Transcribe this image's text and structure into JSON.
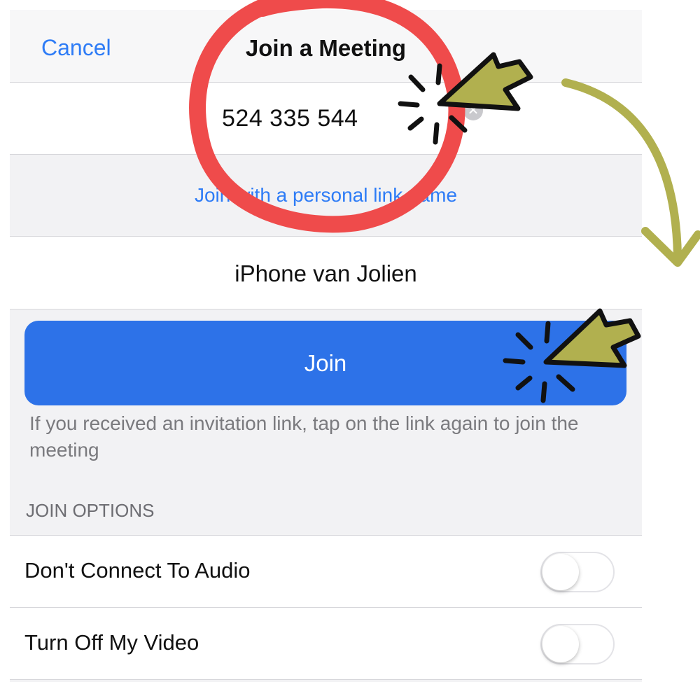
{
  "navbar": {
    "cancel_label": "Cancel",
    "title": "Join a Meeting"
  },
  "meeting": {
    "id_value": "524 335 544",
    "clear_icon": "clear-icon"
  },
  "personal_link": {
    "label": "Join with a personal link name"
  },
  "name_field": {
    "value": "iPhone van Jolien"
  },
  "join_button": {
    "label": "Join"
  },
  "invite_hint": "If you received an invitation link, tap on the link again to join the meeting",
  "join_options": {
    "header": "JOIN OPTIONS",
    "items": [
      {
        "label": "Don't Connect To Audio",
        "enabled": false
      },
      {
        "label": "Turn Off My Video",
        "enabled": false
      }
    ]
  },
  "colors": {
    "accent": "#2e7cf6",
    "join_button": "#2d72e8",
    "annotation_circle": "#ef4b4b",
    "annotation_arrow": "#b1b04f"
  },
  "annotations": [
    "highlight-circle",
    "pointer-arrow-icon",
    "curved-arrow-icon"
  ]
}
